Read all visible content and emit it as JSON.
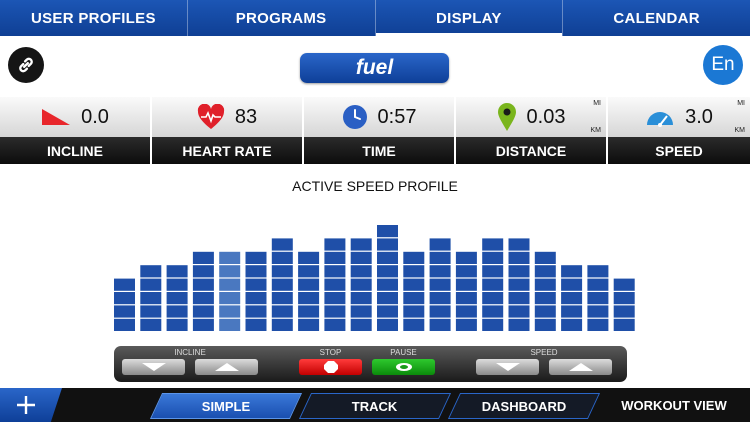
{
  "top_nav": {
    "tabs": [
      {
        "label": "USER PROFILES"
      },
      {
        "label": "PROGRAMS"
      },
      {
        "label": "DISPLAY"
      },
      {
        "label": "CALENDAR"
      }
    ],
    "active_tab": "DISPLAY"
  },
  "header": {
    "logo_text": "fuel",
    "language_label": "En"
  },
  "stats": [
    {
      "name": "incline",
      "value": "0.0",
      "label": "INCLINE",
      "icon": "incline-icon"
    },
    {
      "name": "heart-rate",
      "value": "83",
      "label": "HEART RATE",
      "icon": "heart-icon"
    },
    {
      "name": "time",
      "value": "0:57",
      "label": "TIME",
      "icon": "clock-icon"
    },
    {
      "name": "distance",
      "value": "0.03",
      "label": "DISTANCE",
      "icon": "location-pin-icon",
      "unit_top": "MI",
      "unit_bottom": "KM"
    },
    {
      "name": "speed",
      "value": "3.0",
      "label": "SPEED",
      "icon": "speedometer-icon",
      "unit_top": "MI",
      "unit_bottom": "KM"
    }
  ],
  "profile": {
    "title": "ACTIVE SPEED PROFILE",
    "levels": [
      4,
      5,
      5,
      6,
      6,
      6,
      7,
      6,
      7,
      7,
      8,
      6,
      7,
      6,
      7,
      7,
      6,
      5,
      5,
      4
    ],
    "current_index": 4,
    "bar_color": "#1f4fa8",
    "current_color": "#4a78c0"
  },
  "controls": {
    "incline_label": "INCLINE",
    "stop_label": "STOP",
    "pause_label": "PAUSE",
    "speed_label": "SPEED"
  },
  "bottom_nav": {
    "tabs": [
      {
        "label": "SIMPLE"
      },
      {
        "label": "TRACK"
      },
      {
        "label": "DASHBOARD"
      },
      {
        "label": "WORKOUT VIEW"
      }
    ],
    "active_tab": "SIMPLE"
  },
  "colors": {
    "brand_blue": "#1b4fa8",
    "heart_red": "#e0202a",
    "pin_green": "#7ab51d",
    "clock_blue": "#2a5fc4"
  }
}
